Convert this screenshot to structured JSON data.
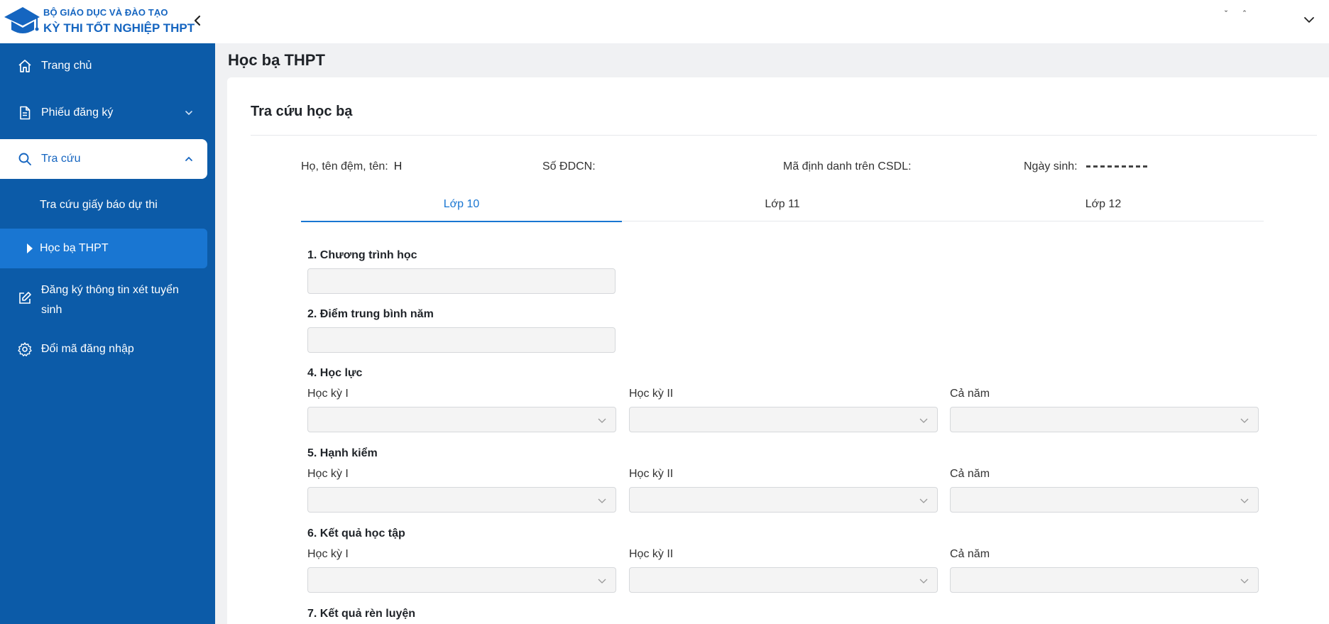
{
  "header": {
    "brand_line1": "BỘ GIÁO DỤC VÀ ĐÀO TẠO",
    "brand_line2": "KỲ THI TỐT NGHIỆP THPT",
    "icons": {
      "logo": "graduation-cap-logo",
      "collapse": "chevron-left-icon",
      "user_menu": "chevron-down-icon"
    },
    "ctrl_down": "ˇ",
    "ctrl_up": "ˆ"
  },
  "sidebar": {
    "items": [
      {
        "label": "Trang chủ",
        "icon": "home-icon"
      },
      {
        "label": "Phiếu đăng ký",
        "icon": "document-icon",
        "caret": "chevron-down-icon"
      },
      {
        "label": "Tra cứu",
        "icon": "search-icon",
        "caret": "chevron-up-icon",
        "active": true
      },
      {
        "label": "Tra cứu giấy báo dự thi"
      },
      {
        "label": "Học bạ THPT",
        "selected": true
      },
      {
        "label_line1": "Đăng ký thông tin xét tuyển",
        "label_line2": "sinh",
        "icon": "edit-icon"
      },
      {
        "label": "Đổi mã đăng nhập",
        "icon": "gear-icon"
      }
    ]
  },
  "main": {
    "page_title": "Học bạ THPT",
    "card_title": "Tra cứu học bạ",
    "info": {
      "name_label": "Họ, tên đệm, tên:",
      "name_value": "H",
      "id_label": "Số ĐDCN:",
      "db_label": "Mã định danh trên CSDL:",
      "dob_label": "Ngày sinh:"
    },
    "tabs": [
      {
        "label": "Lớp 10",
        "active": true
      },
      {
        "label": "Lớp 11"
      },
      {
        "label": "Lớp 12"
      }
    ],
    "sections": {
      "program": "1. Chương trình học",
      "gpa": "2. Điểm trung bình năm",
      "academic": "4. Học lực",
      "conduct": "5. Hạnh kiểm",
      "result": "6. Kết quả học tập",
      "training": "7. Kết quả rèn luyện"
    },
    "term_labels": {
      "term1": "Học kỳ I",
      "term2": "Học kỳ II",
      "year": "Cả năm"
    }
  },
  "colors": {
    "sidebar_bg": "#0c5ba8",
    "accent": "#1976d2",
    "brand": "#1565c0"
  }
}
